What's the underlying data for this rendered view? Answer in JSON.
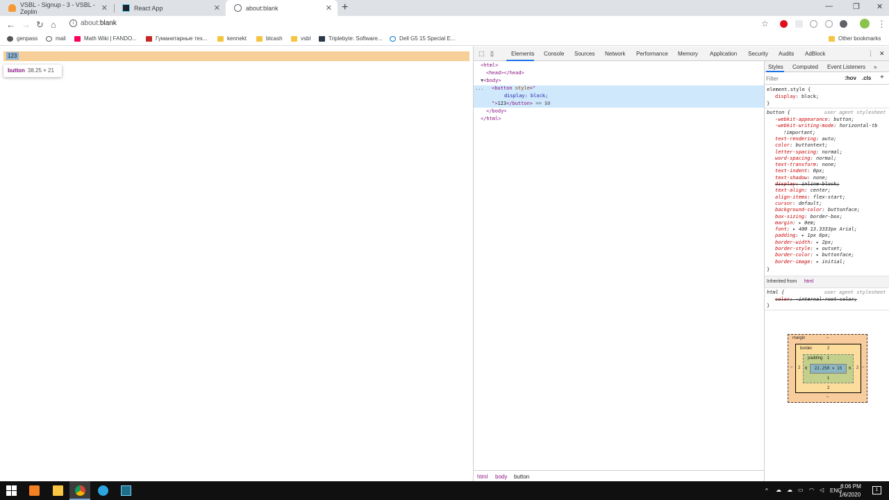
{
  "tabs": [
    {
      "title": "VSBL - Signup - 3 - VSBL - Zeplin",
      "icon": "zeplin-icon"
    },
    {
      "title": "React App",
      "icon": "react-icon"
    },
    {
      "title": "about:blank",
      "icon": "globe-icon"
    }
  ],
  "toolbar": {
    "url_host": "about:",
    "url_path": "blank"
  },
  "bookmarks": [
    {
      "label": "genpass"
    },
    {
      "label": "mail"
    },
    {
      "label": "Math Wiki | FANDO..."
    },
    {
      "label": "Гуманитарные тех..."
    },
    {
      "label": "kennekt"
    },
    {
      "label": "btcash"
    },
    {
      "label": "vsbl"
    },
    {
      "label": "Triplebyte: Software..."
    },
    {
      "label": "Dell G5 15 Special E..."
    }
  ],
  "other_bookmarks": "Other bookmarks",
  "page": {
    "button_text": "123",
    "tooltip_tag": "button",
    "tooltip_size": "38.25 × 21"
  },
  "devtools": {
    "tabs": [
      "Elements",
      "Console",
      "Sources",
      "Network",
      "Performance",
      "Memory",
      "Application",
      "Security",
      "Audits",
      "AdBlock"
    ],
    "dom": {
      "l1": "<html>",
      "l2": "<head></head>",
      "l3": "<body>",
      "l4a": "<button ",
      "l4b": "style",
      "l4c": "=\"",
      "l5": "display: block;",
      "l6a": "\">",
      "l6b": "123",
      "l6c": "</button>",
      "l6d": " == $0",
      "l7": "</body>",
      "l8": "</html>",
      "dots": "..."
    },
    "crumbs": [
      "html",
      "body",
      "button"
    ],
    "styles_tabs": [
      "Styles",
      "Computed",
      "Event Listeners"
    ],
    "filter_placeholder": "Filter",
    "hov": ":hov",
    "cls": ".cls",
    "element_style": {
      "selector": "element.style {",
      "prop": "display",
      "value": "block;",
      "close": "}"
    },
    "ua_source": "user agent stylesheet",
    "button_rule_selector": "button {",
    "button_rules": [
      {
        "p": "-webkit-appearance",
        "v": "button;",
        "strike": false
      },
      {
        "p": "-webkit-writing-mode",
        "v": "horizontal-tb",
        "strike": false
      },
      {
        "p": "",
        "v": "!important;",
        "strike": false
      },
      {
        "p": "text-rendering",
        "v": "auto;",
        "strike": false
      },
      {
        "p": "color",
        "v": "buttontext;",
        "strike": false
      },
      {
        "p": "letter-spacing",
        "v": "normal;",
        "strike": false
      },
      {
        "p": "word-spacing",
        "v": "normal;",
        "strike": false
      },
      {
        "p": "text-transform",
        "v": "none;",
        "strike": false
      },
      {
        "p": "text-indent",
        "v": "0px;",
        "strike": false
      },
      {
        "p": "text-shadow",
        "v": "none;",
        "strike": false
      },
      {
        "p": "display",
        "v": "inline-block;",
        "strike": true
      },
      {
        "p": "text-align",
        "v": "center;",
        "strike": false
      },
      {
        "p": "align-items",
        "v": "flex-start;",
        "strike": false
      },
      {
        "p": "cursor",
        "v": "default;",
        "strike": false
      },
      {
        "p": "background-color",
        "v": "buttonface;",
        "strike": false
      },
      {
        "p": "box-sizing",
        "v": "border-box;",
        "strike": false
      },
      {
        "p": "margin",
        "v": "▸ 0em;",
        "strike": false
      },
      {
        "p": "font",
        "v": "▸ 400 13.3333px Arial;",
        "strike": false
      },
      {
        "p": "padding",
        "v": "▸ 1px 6px;",
        "strike": false
      },
      {
        "p": "border-width",
        "v": "▸ 2px;",
        "strike": false
      },
      {
        "p": "border-style",
        "v": "▸ outset;",
        "strike": false
      },
      {
        "p": "border-color",
        "v": "▸ buttonface;",
        "strike": false
      },
      {
        "p": "border-image",
        "v": "▸ initial;",
        "strike": false
      }
    ],
    "inherited_label": "Inherited from",
    "inherited_tag": "html",
    "html_rule_selector": "html {",
    "html_rule": {
      "p": "color",
      "v": "-internal-root-color;"
    },
    "boxmodel": {
      "margin_label": "margin",
      "margin_top": "–",
      "margin_bottom": "–",
      "margin_left": "–",
      "margin_right": "–",
      "border_label": "border",
      "border_top": "2",
      "border_bottom": "2",
      "border_left": "2",
      "border_right": "2",
      "padding_label": "padding",
      "padding_top": "1",
      "padding_bottom": "1",
      "padding_left": "6",
      "padding_right": "6",
      "content": "22.250 × 15"
    }
  },
  "taskbar": {
    "lang": "ENG",
    "time": "8:06 PM",
    "date": "1/6/2020",
    "notif_count": "1"
  },
  "colors": {
    "accent": "#1a73e8",
    "highlight_margin": "#f6cf99",
    "highlight_content": "#8cb3d6"
  }
}
